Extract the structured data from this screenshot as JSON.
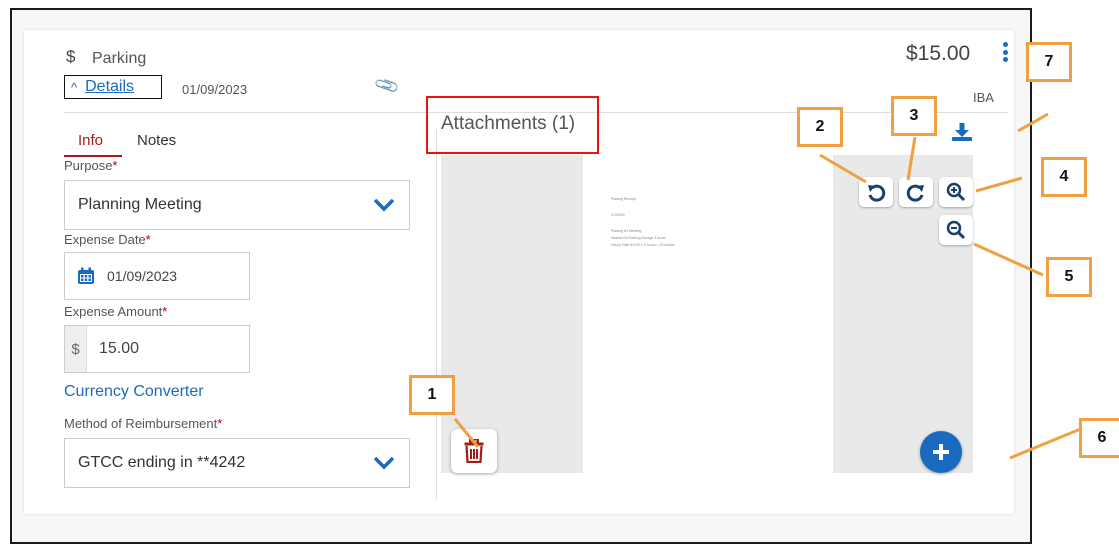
{
  "header": {
    "currency_symbol": "$",
    "category": "Parking",
    "details_label": "Details",
    "date": "01/09/2023",
    "amount": "$15.00",
    "org": "IBA"
  },
  "tabs": [
    {
      "label": "Info",
      "active": true
    },
    {
      "label": "Notes",
      "active": false
    }
  ],
  "form": {
    "purpose_label": "Purpose",
    "purpose_value": "Planning Meeting",
    "expense_date_label": "Expense Date",
    "expense_date_value": "01/09/2023",
    "expense_amount_label": "Expense Amount",
    "expense_amount_symbol": "$",
    "expense_amount_value": "15.00",
    "currency_converter": "Currency Converter",
    "reimbursement_label": "Method of Reimbursement",
    "reimbursement_value": "GTCC ending in **4242",
    "required_marker": "*"
  },
  "attachments": {
    "title": "Attachments (1)",
    "document_lines": [
      "Parking Receipt",
      "01/09/23",
      "Parking for Meeting",
      "Atlanta GA Parking Garage 3 hours",
      "Hourly Rate $ 5.00 x 3 hours = 15 dollars"
    ]
  },
  "callouts": [
    "1",
    "2",
    "3",
    "4",
    "5",
    "6",
    "7"
  ],
  "icons": {
    "rotate_left": "rotate-left-icon",
    "rotate_right": "rotate-right-icon",
    "zoom_in": "zoom-in-icon",
    "zoom_out": "zoom-out-icon",
    "download": "download-icon",
    "delete": "trash-icon",
    "add": "plus-icon",
    "calendar": "calendar-icon",
    "attachment": "paperclip-icon",
    "more": "kebab-icon"
  },
  "colors": {
    "accent_blue": "#1a6bbf",
    "active_tab_red": "#a51c1c",
    "callout_orange": "#f0a040",
    "highlight_red": "#e11"
  }
}
